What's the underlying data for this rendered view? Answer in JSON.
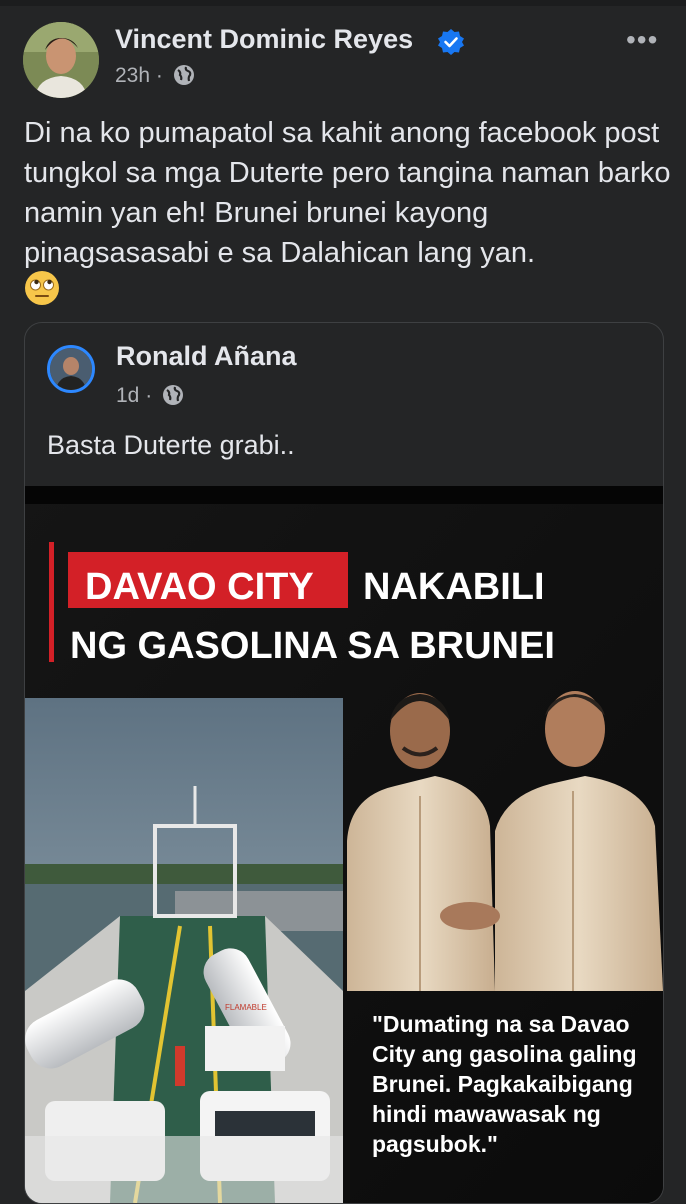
{
  "post": {
    "author": "Vincent Dominic Reyes",
    "time": "23h",
    "separator": "·",
    "more_label": "•••",
    "text": "Di na ko pumapatol sa kahit anong facebook post tungkol sa mga Duterte pero tangina naman barko namin yan eh! Brunei brunei kayong pinagsasasabi e sa Dalahican lang yan.",
    "emoji": "face-with-rolling-eyes"
  },
  "shared": {
    "author": "Ronald Añana",
    "time": "1d",
    "separator": "·",
    "text": "Basta Duterte grabi..",
    "image": {
      "headline_highlight": "DAVAO CITY",
      "headline_rest": "NAKABILI",
      "headline_line2": "NG GASOLINA SA BRUNEI",
      "tanker_label": "FLAMABLE",
      "quote_lines": [
        "\"Dumating na sa Davao",
        "City ang gasolina galing",
        "Brunei. Pagkakaibigang",
        "hindi mawawasak ng",
        "pagsubok.\""
      ]
    }
  },
  "colors": {
    "background": "#242526",
    "text_primary": "#e4e6eb",
    "text_secondary": "#b0b3b8",
    "verified": "#1877f2",
    "headline_red": "#d32027"
  }
}
